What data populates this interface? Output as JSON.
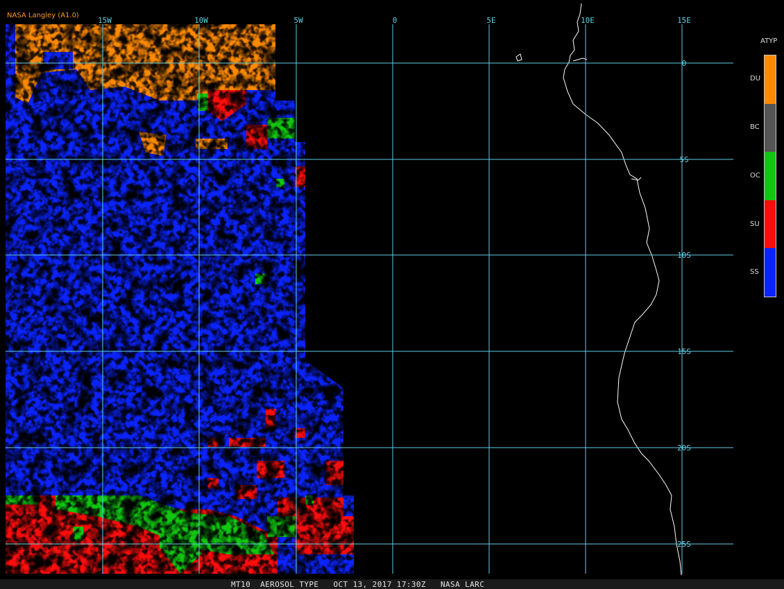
{
  "credit": "NASA Langley (A1.0)",
  "legend": {
    "title": "ATYP",
    "items": [
      {
        "code": "DU",
        "color": "#ff8a00"
      },
      {
        "code": "BC",
        "color": "#555555"
      },
      {
        "code": "OC",
        "color": "#11c711"
      },
      {
        "code": "SU",
        "color": "#ff0d0d"
      },
      {
        "code": "SS",
        "color": "#0b24ff"
      }
    ]
  },
  "longitude_labels": [
    "15W",
    "10W",
    "5W",
    "0",
    "5E",
    "10E",
    "15E"
  ],
  "latitude_labels": [
    "0",
    "5S",
    "10S",
    "15S",
    "20S",
    "25S"
  ],
  "status_bar": {
    "product": "MT10",
    "title": "AEROSOL TYPE",
    "datetime": "OCT 13, 2017 17:30Z",
    "agency": "NASA LARC"
  },
  "colors": {
    "grid": "#5fd0e6",
    "coast": "#ffffff",
    "background": "#000000"
  }
}
